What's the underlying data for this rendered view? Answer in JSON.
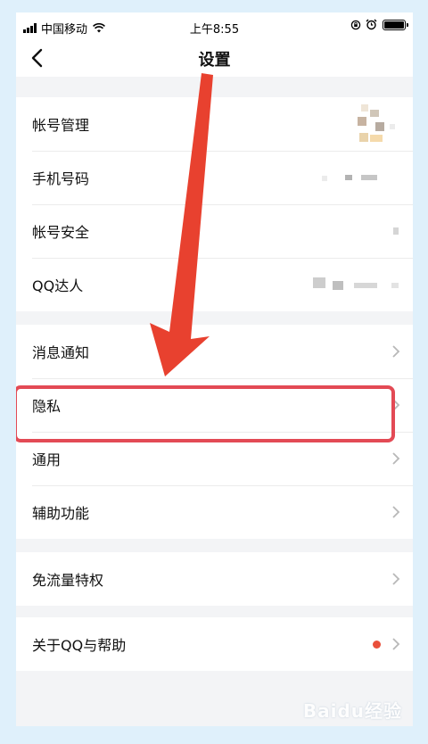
{
  "status_bar": {
    "carrier": "中国移动",
    "time": "上午8:55"
  },
  "nav": {
    "title": "设置",
    "back_icon": "chevron-left-icon"
  },
  "groups": [
    {
      "items": [
        {
          "label": "帐号管理",
          "value": "blurred-avatar"
        },
        {
          "label": "手机号码",
          "value": "blurred"
        },
        {
          "label": "帐号安全",
          "value": "blurred"
        },
        {
          "label": "QQ达人",
          "value": "blurred"
        }
      ]
    },
    {
      "items": [
        {
          "label": "消息通知"
        },
        {
          "label": "隐私",
          "highlighted": true
        },
        {
          "label": "通用"
        },
        {
          "label": "辅助功能"
        }
      ]
    },
    {
      "items": [
        {
          "label": "免流量特权"
        }
      ]
    },
    {
      "items": [
        {
          "label": "关于QQ与帮助",
          "badge": "red-dot"
        }
      ]
    }
  ],
  "annotation": {
    "arrow_color": "#e8412f",
    "highlight_color": "#e34a55"
  },
  "watermark": "Baidu经验",
  "colors": {
    "background": "#f3f4f6",
    "outer_background": "#dff0fb",
    "row_background": "#ffffff",
    "text": "#111111",
    "chevron": "#b8b8b8",
    "badge": "#e94f3b"
  }
}
